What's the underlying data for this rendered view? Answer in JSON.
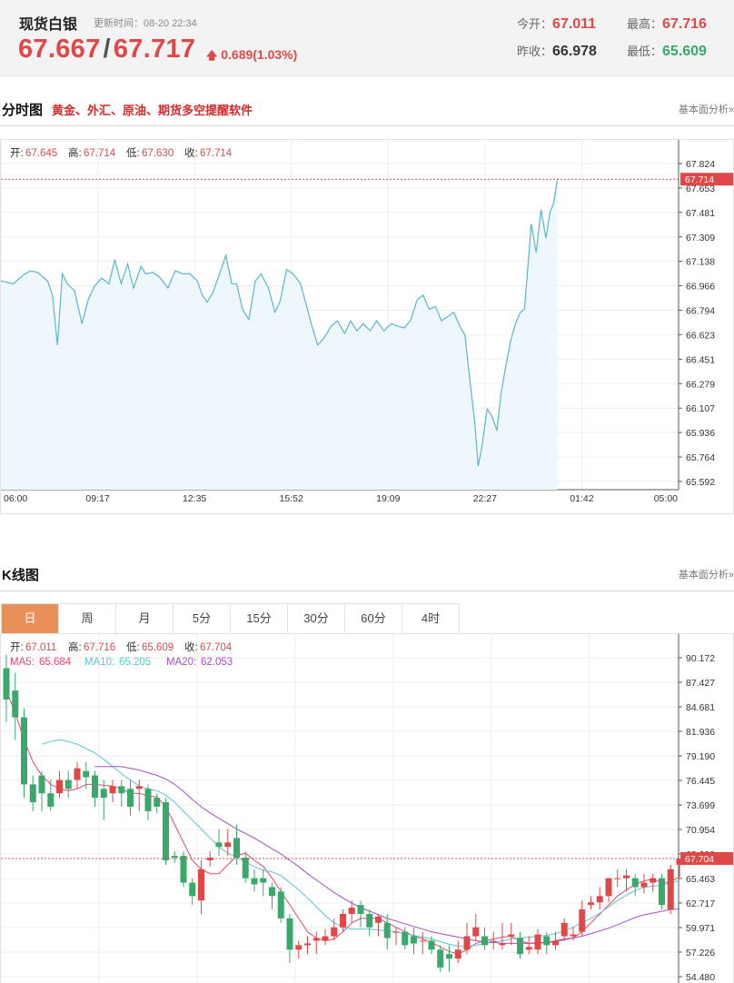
{
  "quote": {
    "name": "现货白银",
    "update_time": "更新时间：08-20 22:34",
    "bid": "67.667",
    "slash": "/",
    "ask": "67.717",
    "change": "0.689(1.03%)",
    "open_label": "今开：",
    "open": "67.011",
    "high_label": "最高：",
    "high": "67.716",
    "prev_label": "昨收：",
    "prev_close": "66.978",
    "low_label": "最低：",
    "low": "65.609"
  },
  "intraday_section": {
    "title": "分时图",
    "promo": "黄金、外汇、原油、期货多空提醒软件",
    "link": "基本面分析»"
  },
  "kline_section": {
    "title": "K线图",
    "link": "基本面分析»",
    "tabs": [
      "日",
      "周",
      "月",
      "5分",
      "15分",
      "30分",
      "60分",
      "4时"
    ],
    "active_tab": "日"
  },
  "colors": {
    "up": "#e04848",
    "down": "#3aa86b",
    "intraday_line": "#5ab5d0",
    "ma5": "#e8466e",
    "ma10": "#5ac4d6",
    "ma20": "#a64fc2"
  },
  "chart_data": [
    {
      "type": "line",
      "name": "intraday",
      "info": [
        {
          "label": "开:",
          "value": "67.645"
        },
        {
          "label": "高:",
          "value": "67.714"
        },
        {
          "label": "低:",
          "value": "67.630"
        },
        {
          "label": "收:",
          "value": "67.714"
        }
      ],
      "y_ticks": [
        "67.824",
        "67.653",
        "67.481",
        "67.309",
        "67.138",
        "66.966",
        "66.794",
        "66.623",
        "66.451",
        "66.279",
        "66.107",
        "65.936",
        "65.764",
        "65.592"
      ],
      "x_ticks": [
        "06:00",
        "09:17",
        "12:35",
        "15:52",
        "19:09",
        "22:27",
        "01:42",
        "05:00"
      ],
      "ylim": [
        65.592,
        67.824
      ],
      "current_price": "67.714",
      "total_minutes": 1380,
      "path": [
        [
          0,
          67.0
        ],
        [
          25,
          66.98
        ],
        [
          45,
          67.04
        ],
        [
          60,
          67.07
        ],
        [
          75,
          67.06
        ],
        [
          95,
          67.0
        ],
        [
          105,
          66.9
        ],
        [
          115,
          66.55
        ],
        [
          125,
          67.05
        ],
        [
          135,
          66.98
        ],
        [
          150,
          66.93
        ],
        [
          165,
          66.7
        ],
        [
          178,
          66.87
        ],
        [
          190,
          66.96
        ],
        [
          205,
          67.02
        ],
        [
          220,
          66.98
        ],
        [
          232,
          67.15
        ],
        [
          245,
          66.98
        ],
        [
          258,
          67.12
        ],
        [
          270,
          66.95
        ],
        [
          285,
          67.1
        ],
        [
          295,
          67.05
        ],
        [
          310,
          67.06
        ],
        [
          325,
          67.02
        ],
        [
          340,
          66.95
        ],
        [
          355,
          67.07
        ],
        [
          370,
          67.05
        ],
        [
          385,
          67.05
        ],
        [
          400,
          67.0
        ],
        [
          410,
          66.9
        ],
        [
          420,
          66.85
        ],
        [
          432,
          66.92
        ],
        [
          445,
          67.05
        ],
        [
          458,
          67.18
        ],
        [
          470,
          66.98
        ],
        [
          480,
          66.98
        ],
        [
          492,
          66.8
        ],
        [
          505,
          66.73
        ],
        [
          518,
          67.0
        ],
        [
          530,
          67.05
        ],
        [
          545,
          66.95
        ],
        [
          558,
          66.78
        ],
        [
          568,
          66.85
        ],
        [
          582,
          67.08
        ],
        [
          595,
          67.05
        ],
        [
          610,
          66.98
        ],
        [
          622,
          66.83
        ],
        [
          632,
          66.7
        ],
        [
          645,
          66.55
        ],
        [
          658,
          66.6
        ],
        [
          672,
          66.68
        ],
        [
          685,
          66.72
        ],
        [
          700,
          66.63
        ],
        [
          712,
          66.72
        ],
        [
          725,
          66.65
        ],
        [
          738,
          66.7
        ],
        [
          752,
          66.65
        ],
        [
          765,
          66.72
        ],
        [
          780,
          66.65
        ],
        [
          795,
          66.7
        ],
        [
          810,
          66.68
        ],
        [
          822,
          66.67
        ],
        [
          835,
          66.73
        ],
        [
          848,
          66.87
        ],
        [
          860,
          66.9
        ],
        [
          872,
          66.8
        ],
        [
          885,
          66.82
        ],
        [
          897,
          66.72
        ],
        [
          910,
          66.75
        ],
        [
          922,
          66.78
        ],
        [
          935,
          66.68
        ],
        [
          945,
          66.62
        ],
        [
          955,
          66.3
        ],
        [
          965,
          66.0
        ],
        [
          972,
          65.7
        ],
        [
          980,
          65.85
        ],
        [
          990,
          66.1
        ],
        [
          1000,
          66.05
        ],
        [
          1010,
          65.95
        ],
        [
          1018,
          66.2
        ],
        [
          1028,
          66.4
        ],
        [
          1038,
          66.58
        ],
        [
          1048,
          66.7
        ],
        [
          1058,
          66.78
        ],
        [
          1066,
          66.8
        ],
        [
          1072,
          67.05
        ],
        [
          1080,
          67.4
        ],
        [
          1090,
          67.2
        ],
        [
          1100,
          67.5
        ],
        [
          1110,
          67.3
        ],
        [
          1118,
          67.48
        ],
        [
          1126,
          67.55
        ],
        [
          1133,
          67.714
        ]
      ]
    },
    {
      "type": "candlestick",
      "name": "daily-kline",
      "info": [
        {
          "label": "开:",
          "value": "67.011"
        },
        {
          "label": "高:",
          "value": "67.716"
        },
        {
          "label": "低:",
          "value": "65.609"
        },
        {
          "label": "收:",
          "value": "67.704"
        }
      ],
      "ma_info": [
        {
          "label": "MA5:",
          "value": "65.684",
          "color_key": "ma5"
        },
        {
          "label": "MA10:",
          "value": "65.205",
          "color_key": "ma10"
        },
        {
          "label": "MA20:",
          "value": "62.053",
          "color_key": "ma20"
        }
      ],
      "y_ticks": [
        "90.172",
        "87.427",
        "84.681",
        "81.936",
        "79.190",
        "76.445",
        "73.699",
        "70.954",
        "68.208",
        "65.463",
        "62.717",
        "59.971",
        "57.226",
        "54.480"
      ],
      "ylim": [
        54.48,
        90.172
      ],
      "current_price": "67.704",
      "candles": [
        [
          89.0,
          85.5,
          90.5,
          83.0
        ],
        [
          86.5,
          83.5,
          88.5,
          81.0
        ],
        [
          83.5,
          76.0,
          84.5,
          74.5
        ],
        [
          76.0,
          74.0,
          77.0,
          73.0
        ],
        [
          77.0,
          75.0,
          77.5,
          73.0
        ],
        [
          75.0,
          73.5,
          76.5,
          73.0
        ],
        [
          75.0,
          76.5,
          77.5,
          74.5
        ],
        [
          76.5,
          75.5,
          77.5,
          74.5
        ],
        [
          76.5,
          77.8,
          78.5,
          75.5
        ],
        [
          77.5,
          76.8,
          78.5,
          75.5
        ],
        [
          77.0,
          74.5,
          77.5,
          73.5
        ],
        [
          75.5,
          74.5,
          76.5,
          72.0
        ],
        [
          75.0,
          75.8,
          76.5,
          74.0
        ],
        [
          75.8,
          75.0,
          76.5,
          73.5
        ],
        [
          75.5,
          73.5,
          76.5,
          72.5
        ],
        [
          75.5,
          75.8,
          76.5,
          73.0
        ],
        [
          75.5,
          73.0,
          76.0,
          72.0
        ],
        [
          74.5,
          73.5,
          75.0,
          72.8
        ],
        [
          74.0,
          67.5,
          74.5,
          67.0
        ],
        [
          68.0,
          67.8,
          68.5,
          67.2
        ],
        [
          68.0,
          65.0,
          68.5,
          64.5
        ],
        [
          65.0,
          63.5,
          65.5,
          62.5
        ],
        [
          63.0,
          66.5,
          67.5,
          61.5
        ],
        [
          67.5,
          67.8,
          68.5,
          66.8
        ],
        [
          69.5,
          69.0,
          71.0,
          68.0
        ],
        [
          69.0,
          69.5,
          71.0,
          68.0
        ],
        [
          70.0,
          67.8,
          71.5,
          67.0
        ],
        [
          67.8,
          65.5,
          68.5,
          65.0
        ],
        [
          65.5,
          64.8,
          66.5,
          64.0
        ],
        [
          65.5,
          65.0,
          66.5,
          63.5
        ],
        [
          64.5,
          63.5,
          65.0,
          62.0
        ],
        [
          64.0,
          61.0,
          64.5,
          60.5
        ],
        [
          61.0,
          57.5,
          61.5,
          56.0
        ],
        [
          57.5,
          58.0,
          58.5,
          56.5
        ],
        [
          58.0,
          58.2,
          59.0,
          57.0
        ],
        [
          58.5,
          58.8,
          59.5,
          57.0
        ],
        [
          58.5,
          59.0,
          59.8,
          58.0
        ],
        [
          59.0,
          60.0,
          61.0,
          58.5
        ],
        [
          60.0,
          61.5,
          62.0,
          59.5
        ],
        [
          61.5,
          62.2,
          63.0,
          60.5
        ],
        [
          62.5,
          61.5,
          63.0,
          60.0
        ],
        [
          61.5,
          60.0,
          62.0,
          59.0
        ],
        [
          60.5,
          61.2,
          61.5,
          59.0
        ],
        [
          60.5,
          58.8,
          61.5,
          57.5
        ],
        [
          59.5,
          59.5,
          60.0,
          58.0
        ],
        [
          59.5,
          58.0,
          60.0,
          57.5
        ],
        [
          59.0,
          58.2,
          60.0,
          57.0
        ],
        [
          58.5,
          58.5,
          59.5,
          57.0
        ],
        [
          58.5,
          57.5,
          59.0,
          57.0
        ],
        [
          57.5,
          55.5,
          58.0,
          55.0
        ],
        [
          57.0,
          56.5,
          58.0,
          55.0
        ],
        [
          56.5,
          57.5,
          58.5,
          56.0
        ],
        [
          57.5,
          59.0,
          60.5,
          57.0
        ],
        [
          59.0,
          60.0,
          61.5,
          58.5
        ],
        [
          59.0,
          58.0,
          60.0,
          57.5
        ],
        [
          58.5,
          58.5,
          59.5,
          57.5
        ],
        [
          58.0,
          58.2,
          60.5,
          57.5
        ],
        [
          59.0,
          59.2,
          60.5,
          58.0
        ],
        [
          58.8,
          57.0,
          59.5,
          56.5
        ],
        [
          57.5,
          57.8,
          59.0,
          57.0
        ],
        [
          57.5,
          59.2,
          59.8,
          57.0
        ],
        [
          59.0,
          58.0,
          59.5,
          57.0
        ],
        [
          58.0,
          58.5,
          59.5,
          57.5
        ],
        [
          59.0,
          60.5,
          61.0,
          58.5
        ],
        [
          59.0,
          59.2,
          60.0,
          58.5
        ],
        [
          59.5,
          62.0,
          63.0,
          59.0
        ],
        [
          62.5,
          62.8,
          63.5,
          62.0
        ],
        [
          62.8,
          63.5,
          64.5,
          62.0
        ],
        [
          63.5,
          65.5,
          65.5,
          62.8
        ],
        [
          65.5,
          65.5,
          66.5,
          64.5
        ],
        [
          65.5,
          65.8,
          66.5,
          64.0
        ],
        [
          65.5,
          64.5,
          66.0,
          63.5
        ],
        [
          64.5,
          65.0,
          66.0,
          63.8
        ],
        [
          65.0,
          65.5,
          66.0,
          64.0
        ],
        [
          65.5,
          62.5,
          66.0,
          62.0
        ],
        [
          62.0,
          66.5,
          67.0,
          61.5
        ],
        [
          67.0,
          67.7,
          67.7,
          65.6
        ]
      ],
      "ma5": [
        86.5,
        84.0,
        81.0,
        78.5,
        77.0,
        76.0,
        75.5,
        75.3,
        75.5,
        76.0,
        76.0,
        75.9,
        75.8,
        75.5,
        75.0,
        75.0,
        74.7,
        74.6,
        73.5,
        71.5,
        69.5,
        67.5,
        66.5,
        66.0,
        66.0,
        67.0,
        68.0,
        68.3,
        67.5,
        66.8,
        65.5,
        64.0,
        62.5,
        61.0,
        59.5,
        58.8,
        58.5,
        58.7,
        59.5,
        60.5,
        61.0,
        61.0,
        61.0,
        60.5,
        60.0,
        59.5,
        59.0,
        58.7,
        58.3,
        57.8,
        57.3,
        57.0,
        57.5,
        58.2,
        58.5,
        58.7,
        58.9,
        59.0,
        58.5,
        58.2,
        58.3,
        58.3,
        58.5,
        58.7,
        58.8,
        59.5,
        60.5,
        61.5,
        62.5,
        63.5,
        64.2,
        64.8,
        65.2,
        65.4,
        65.0,
        65.1,
        65.684
      ],
      "ma10": [
        null,
        null,
        null,
        null,
        80.5,
        80.8,
        81.0,
        80.8,
        80.5,
        80.0,
        79.5,
        78.8,
        78.0,
        77.2,
        76.5,
        75.8,
        75.5,
        75.3,
        74.8,
        74.0,
        73.0,
        72.0,
        71.0,
        70.0,
        69.0,
        68.3,
        67.8,
        67.3,
        66.8,
        66.4,
        66.2,
        65.8,
        65.0,
        64.2,
        63.3,
        62.3,
        61.3,
        60.5,
        60.0,
        59.8,
        59.8,
        59.8,
        59.7,
        59.6,
        59.5,
        59.3,
        59.1,
        58.9,
        58.7,
        58.4,
        58.1,
        57.9,
        57.9,
        58.0,
        58.2,
        58.3,
        58.5,
        58.7,
        58.8,
        58.9,
        59.0,
        59.1,
        59.3,
        59.6,
        60.0,
        60.5,
        61.0,
        61.6,
        62.3,
        63.0,
        63.6,
        64.1,
        64.5,
        64.6,
        64.7,
        65.0,
        65.205
      ],
      "ma20": [
        null,
        null,
        null,
        null,
        null,
        null,
        null,
        null,
        null,
        null,
        78.0,
        78.0,
        78.0,
        78.0,
        77.8,
        77.6,
        77.3,
        77.0,
        76.6,
        76.0,
        75.2,
        74.3,
        73.5,
        72.8,
        72.2,
        71.6,
        71.0,
        70.5,
        70.0,
        69.4,
        68.8,
        68.2,
        67.5,
        66.8,
        66.0,
        65.3,
        64.6,
        63.9,
        63.3,
        62.7,
        62.2,
        61.8,
        61.4,
        61.0,
        60.7,
        60.4,
        60.1,
        59.8,
        59.5,
        59.3,
        59.1,
        58.9,
        58.7,
        58.5,
        58.4,
        58.3,
        58.2,
        58.2,
        58.2,
        58.2,
        58.2,
        58.3,
        58.4,
        58.6,
        58.8,
        59.0,
        59.3,
        59.6,
        59.9,
        60.3,
        60.7,
        61.1,
        61.4,
        61.6,
        61.8,
        62.0,
        62.053
      ]
    }
  ]
}
